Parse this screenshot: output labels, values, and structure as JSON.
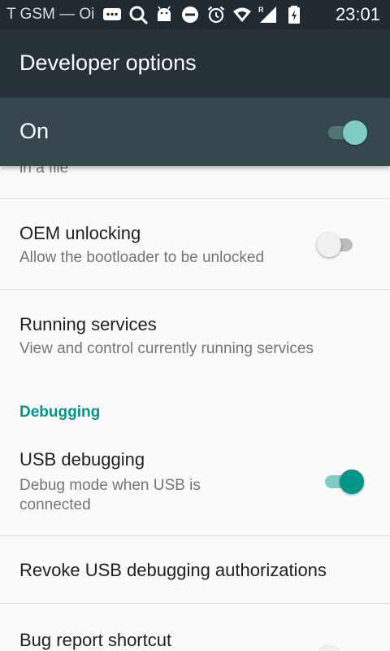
{
  "status_bar": {
    "left_text": "T GSM — Oi",
    "time": "23:01",
    "icons": [
      "messages-icon",
      "search-icon",
      "android-icon",
      "do-not-disturb-icon",
      "alarm-icon",
      "wifi-icon",
      "signal-icon",
      "battery-icon"
    ],
    "roaming_marker": "R"
  },
  "app_bar": {
    "title": "Developer options"
  },
  "master_switch": {
    "label": "On",
    "state": "on"
  },
  "settings": {
    "partial_summary": "in a file",
    "oem_unlocking": {
      "title": "OEM unlocking",
      "summary": "Allow the bootloader to be unlocked",
      "state": "off"
    },
    "running_services": {
      "title": "Running services",
      "summary": "View and control currently running services"
    },
    "debugging_category": "Debugging",
    "usb_debugging": {
      "title": "USB debugging",
      "summary": "Debug mode when USB is connected",
      "state": "on"
    },
    "revoke_usb": {
      "title": "Revoke USB debugging authorizations"
    },
    "bug_report": {
      "title": "Bug report shortcut",
      "state": "off"
    }
  },
  "colors": {
    "status_bar": "#202a30",
    "app_bar": "#263238",
    "master_bar": "#37474f",
    "accent": "#009688",
    "background": "#fafafa"
  }
}
